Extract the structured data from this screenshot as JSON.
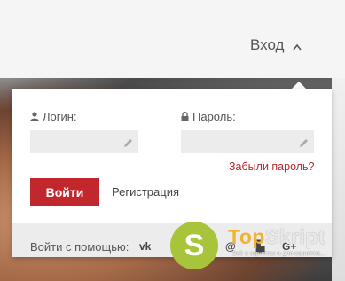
{
  "header": {
    "login_toggle_label": "Вход"
  },
  "form": {
    "login_label": "Логин:",
    "password_label": "Пароль:",
    "login_value": "",
    "password_value": "",
    "forgot_label": "Забыли пароль?",
    "submit_label": "Войти",
    "register_label": "Регистрация"
  },
  "social": {
    "label": "Войти с помощью:",
    "items": [
      {
        "name": "vk-icon",
        "glyph": "vk"
      },
      {
        "name": "mail-icon",
        "glyph": "@"
      },
      {
        "name": "odnoklassniki-icon",
        "glyph": "▙"
      },
      {
        "name": "google-plus-icon",
        "glyph": "G+"
      }
    ]
  },
  "watermark": {
    "letter": "S",
    "brand_part1": "Top",
    "brand_part2": "Skript",
    "tagline": "Всё о скриптах и для скриптов..."
  },
  "colors": {
    "accent": "#c1272d",
    "link": "#b5282e",
    "field_bg": "#ececec",
    "watermark_green": "#a8c43a",
    "watermark_orange": "#f2b233"
  }
}
